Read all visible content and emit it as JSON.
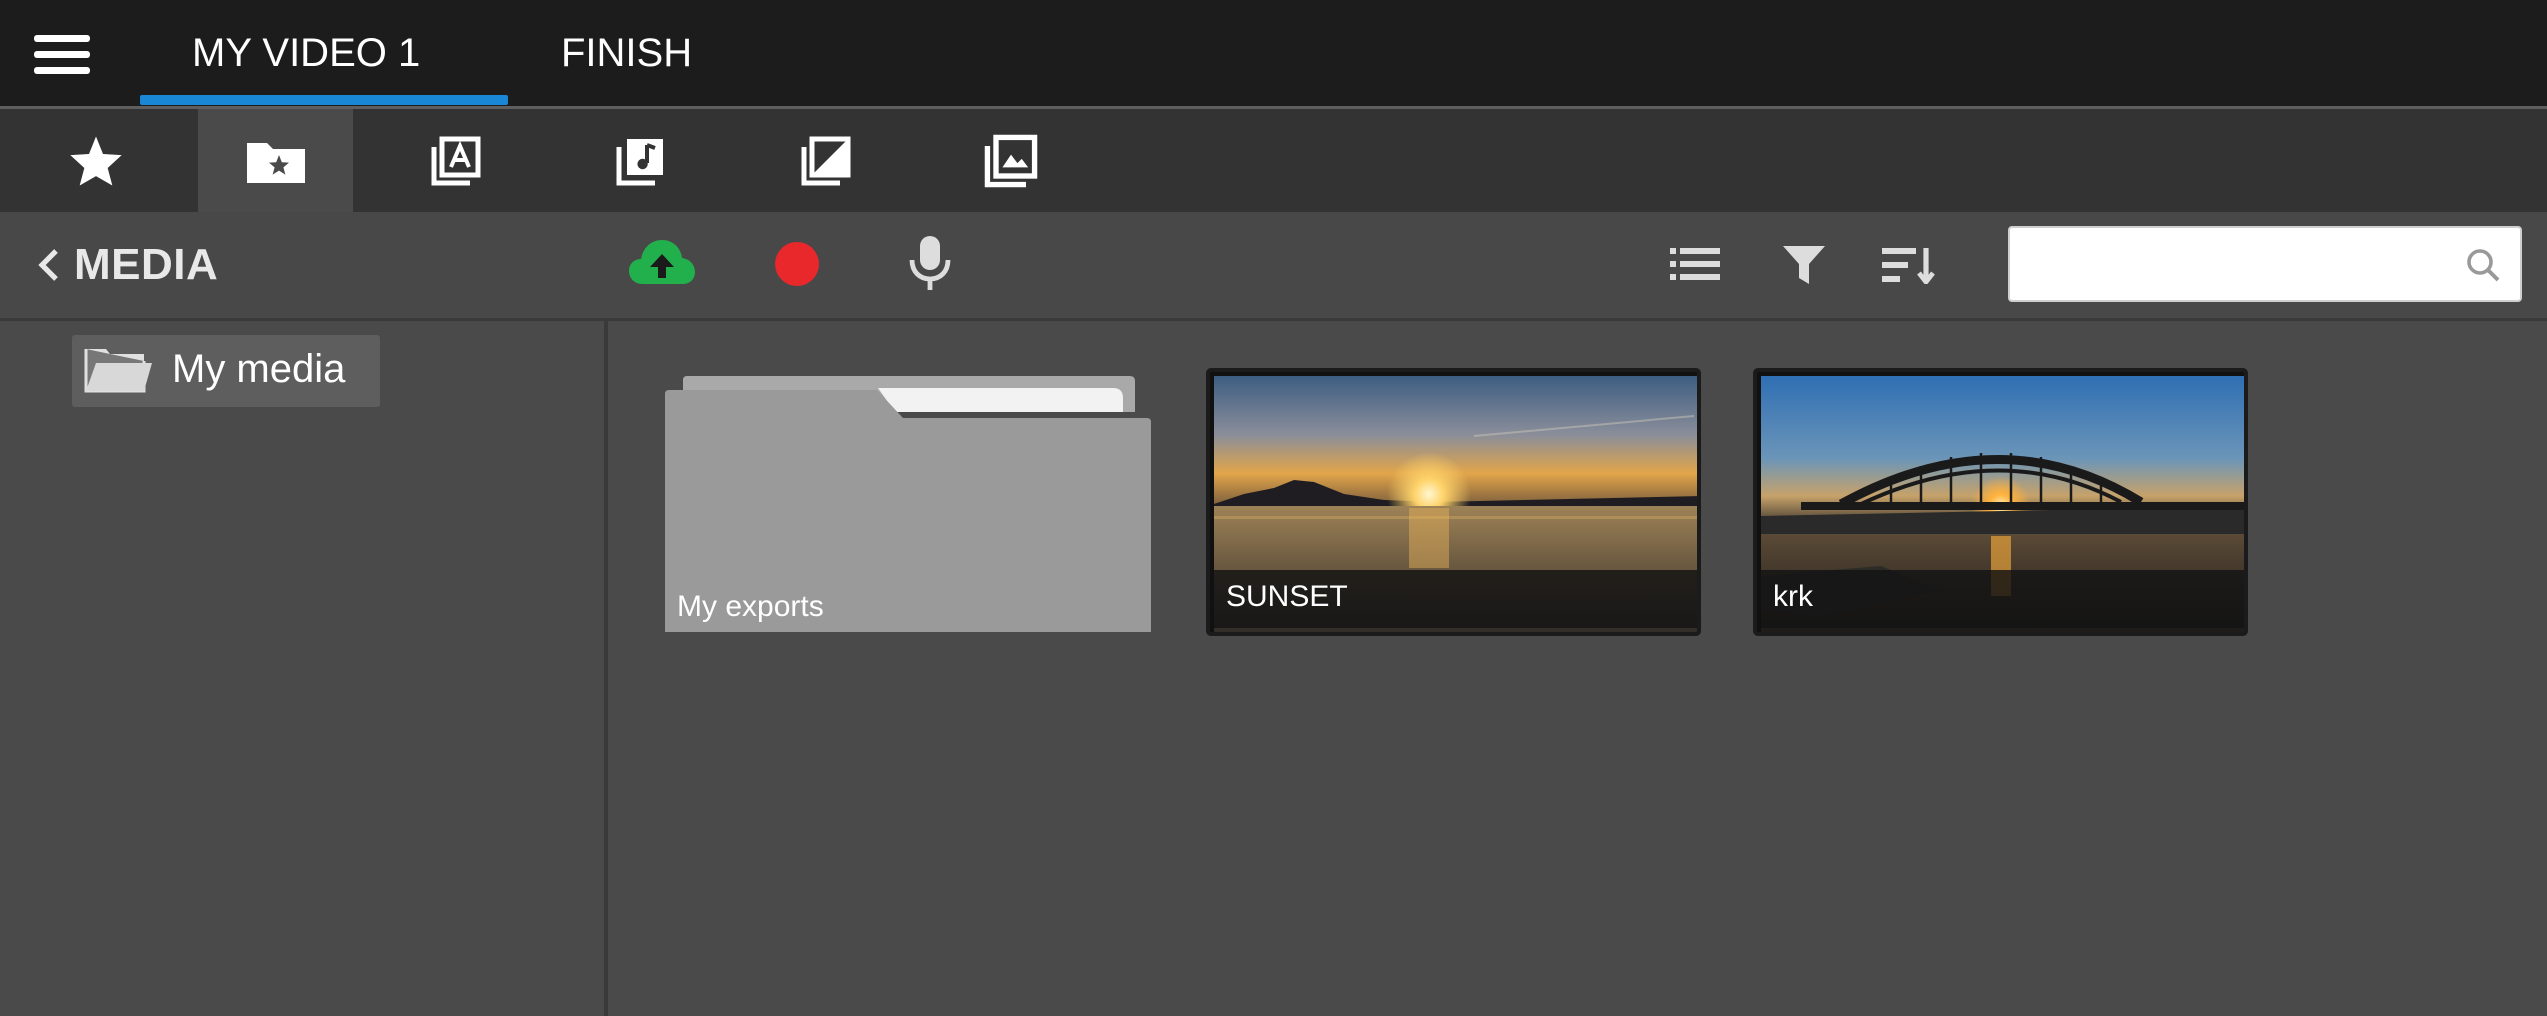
{
  "topbar": {
    "menu_icon": "hamburger-menu-icon",
    "tabs": [
      {
        "label": "MY VIDEO 1",
        "active": true
      },
      {
        "label": "FINISH",
        "active": false
      }
    ],
    "accent_color": "#1a86d6"
  },
  "categories": [
    {
      "name": "favorites",
      "icon": "star-icon",
      "active": false
    },
    {
      "name": "my-media",
      "icon": "folder-star-icon",
      "active": true
    },
    {
      "name": "text",
      "icon": "text-layers-icon",
      "active": false
    },
    {
      "name": "music",
      "icon": "music-note-icon",
      "active": false
    },
    {
      "name": "overlays",
      "icon": "overlay-icon",
      "active": false
    },
    {
      "name": "backgrounds",
      "icon": "image-stack-icon",
      "active": false
    }
  ],
  "media_bar": {
    "back_label": "MEDIA",
    "tools": [
      {
        "name": "upload",
        "icon": "cloud-upload-icon",
        "color": "#22b04c"
      },
      {
        "name": "record",
        "icon": "record-icon",
        "color": "#e8282b"
      },
      {
        "name": "voiceover",
        "icon": "microphone-icon",
        "color": "#dddddd"
      },
      {
        "name": "list-view",
        "icon": "list-icon"
      },
      {
        "name": "filter",
        "icon": "filter-icon"
      },
      {
        "name": "sort",
        "icon": "sort-icon"
      }
    ],
    "search": {
      "value": "",
      "placeholder": "",
      "icon": "search-icon"
    }
  },
  "folders": [
    {
      "label": "My media",
      "icon": "folder-open-icon",
      "selected": true
    }
  ],
  "media_items": [
    {
      "label": "My exports",
      "type": "folder"
    },
    {
      "label": "SUNSET",
      "type": "video"
    },
    {
      "label": "krk",
      "type": "video"
    }
  ]
}
